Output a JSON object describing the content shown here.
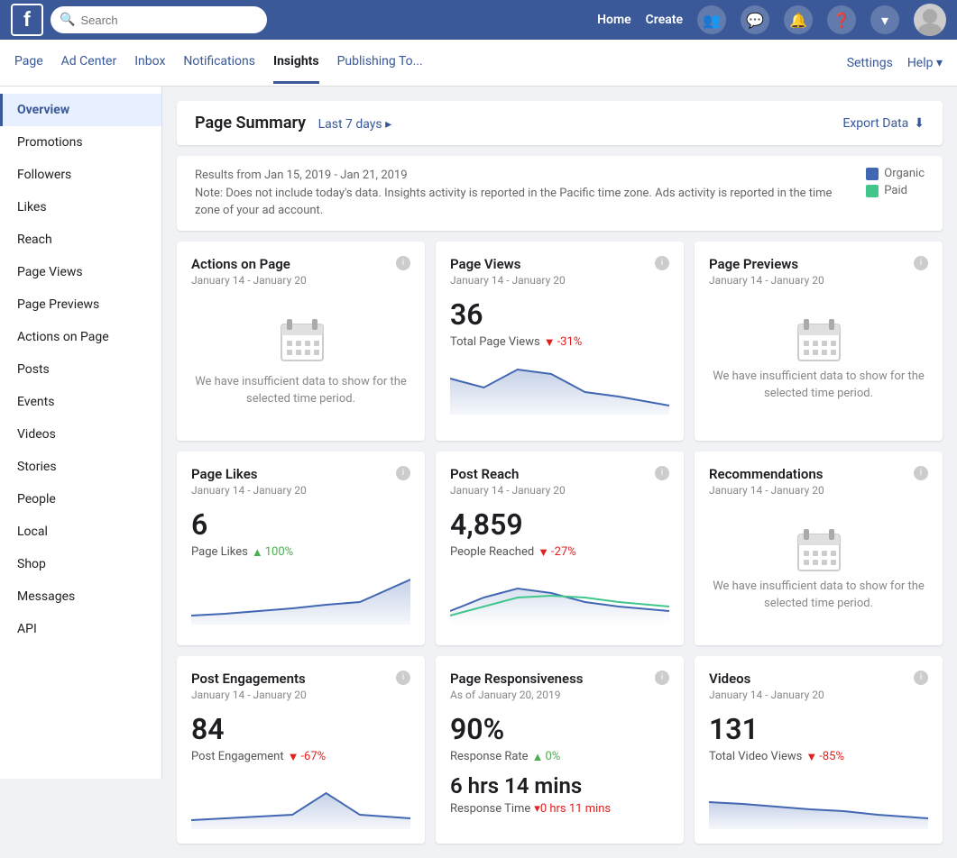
{
  "topnav": {
    "logo": "f",
    "search_placeholder": "Search",
    "links": [
      "Home",
      "Create"
    ],
    "icons": [
      "people",
      "messenger",
      "bell",
      "help",
      "chevron"
    ]
  },
  "pagenav": {
    "items": [
      {
        "label": "Page",
        "active": false
      },
      {
        "label": "Ad Center",
        "active": false
      },
      {
        "label": "Inbox",
        "active": false
      },
      {
        "label": "Notifications",
        "active": false
      },
      {
        "label": "Insights",
        "active": true
      },
      {
        "label": "Publishing To...",
        "active": false
      }
    ],
    "right": [
      "Settings",
      "Help ▾"
    ]
  },
  "sidebar": {
    "items": [
      {
        "label": "Overview",
        "active": true
      },
      {
        "label": "Promotions",
        "active": false
      },
      {
        "label": "Followers",
        "active": false
      },
      {
        "label": "Likes",
        "active": false
      },
      {
        "label": "Reach",
        "active": false
      },
      {
        "label": "Page Views",
        "active": false
      },
      {
        "label": "Page Previews",
        "active": false
      },
      {
        "label": "Actions on Page",
        "active": false
      },
      {
        "label": "Posts",
        "active": false
      },
      {
        "label": "Events",
        "active": false
      },
      {
        "label": "Videos",
        "active": false
      },
      {
        "label": "Stories",
        "active": false
      },
      {
        "label": "People",
        "active": false
      },
      {
        "label": "Local",
        "active": false
      },
      {
        "label": "Shop",
        "active": false
      },
      {
        "label": "Messages",
        "active": false
      },
      {
        "label": "API",
        "active": false
      }
    ]
  },
  "summary": {
    "title": "Page Summary",
    "date_range": "Last 7 days ▸",
    "export_label": "Export Data"
  },
  "info_bar": {
    "dates": "Results from Jan 15, 2019 - Jan 21, 2019",
    "note": "Note: Does not include today's data. Insights activity is reported in the Pacific time zone. Ads activity is reported in the time zone of your ad account.",
    "legend": [
      {
        "label": "Organic",
        "color": "#4267B2"
      },
      {
        "label": "Paid",
        "color": "#41C78C"
      }
    ]
  },
  "cards": [
    {
      "title": "Actions on Page",
      "date": "January 14 - January 20",
      "type": "insufficient",
      "message": "We have insufficient data to show for the selected time period."
    },
    {
      "title": "Page Views",
      "date": "January 14 - January 20",
      "type": "value",
      "value": "36",
      "label": "Total Page Views",
      "change": "-31%",
      "change_dir": "down",
      "has_chart": true,
      "chart_color": "#4267B2"
    },
    {
      "title": "Page Previews",
      "date": "January 14 - January 20",
      "type": "insufficient",
      "message": "We have insufficient data to show for the selected time period."
    },
    {
      "title": "Page Likes",
      "date": "January 14 - January 20",
      "type": "value",
      "value": "6",
      "label": "Page Likes",
      "change": "100%",
      "change_dir": "up",
      "has_chart": true,
      "chart_color": "#4267B2"
    },
    {
      "title": "Post Reach",
      "date": "January 14 - January 20",
      "type": "value",
      "value": "4,859",
      "label": "People Reached",
      "change": "-27%",
      "change_dir": "down",
      "has_chart": true,
      "chart_color_organic": "#4267B2",
      "chart_color_paid": "#41C78C"
    },
    {
      "title": "Recommendations",
      "date": "January 14 - January 20",
      "type": "insufficient",
      "message": "We have insufficient data to show for the selected time period."
    },
    {
      "title": "Post Engagements",
      "date": "January 14 - January 20",
      "type": "value",
      "value": "84",
      "label": "Post Engagement",
      "change": "-67%",
      "change_dir": "down",
      "has_chart": true,
      "chart_color": "#4267B2"
    },
    {
      "title": "Page Responsiveness",
      "date": "As of January 20, 2019",
      "type": "responsiveness",
      "value1": "90%",
      "label1": "Response Rate",
      "change1": "0%",
      "change_dir1": "up",
      "value2": "6 hrs 14 mins",
      "label2": "Response Time",
      "change2": "▾0 hrs 11 mins",
      "change_dir2": "down"
    },
    {
      "title": "Videos",
      "date": "January 14 - January 20",
      "type": "value",
      "value": "131",
      "label": "Total Video Views",
      "change": "-85%",
      "change_dir": "down",
      "has_chart": true,
      "chart_color": "#4267B2"
    }
  ]
}
